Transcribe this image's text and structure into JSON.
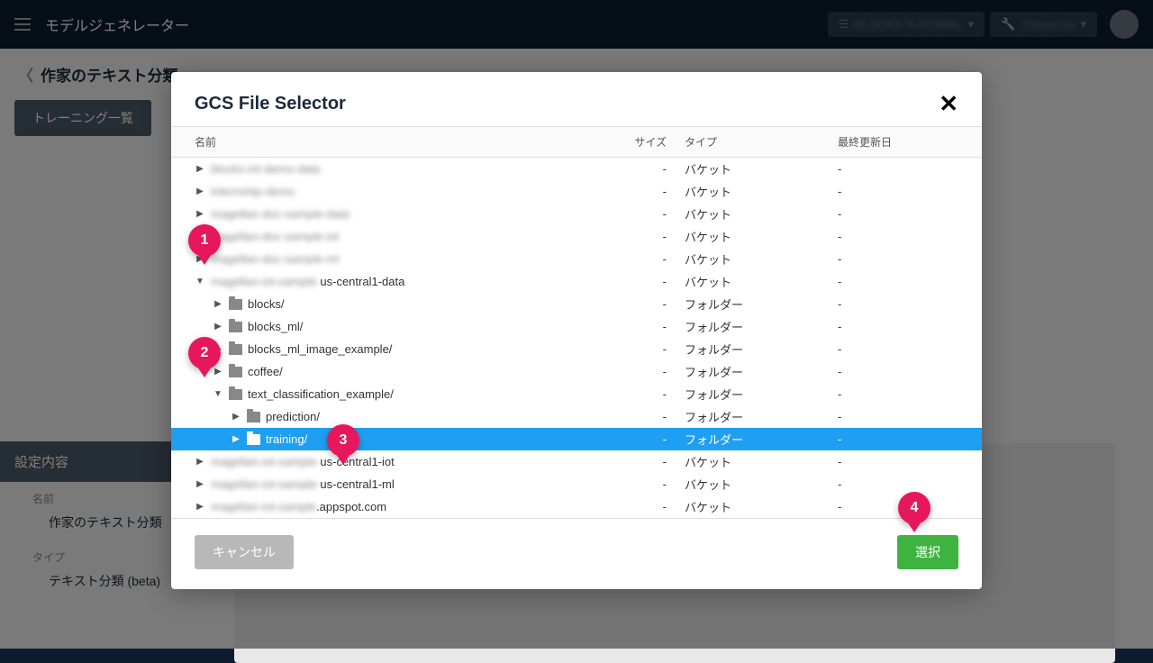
{
  "app": {
    "title": "モデルジェネレーター"
  },
  "breadcrumb": {
    "title": "作家のテキスト分類"
  },
  "tabs": {
    "training_list": "トレーニング一覧"
  },
  "settings": {
    "header": "設定内容",
    "name_label": "名前",
    "name_value": "作家のテキスト分類",
    "type_label": "タイプ",
    "type_value": "テキスト分類 (beta)"
  },
  "modal": {
    "title": "GCS File Selector",
    "columns": {
      "name": "名前",
      "size": "サイズ",
      "type": "タイプ",
      "updated": "最終更新日"
    },
    "buttons": {
      "cancel": "キャンセル",
      "select": "選択"
    },
    "types": {
      "bucket": "バケット",
      "folder": "フォルダー"
    },
    "rows": [
      {
        "indent": 1,
        "arrow": "right",
        "icon": "",
        "name": "blocks-ml-demo-data",
        "blur": true,
        "size": "-",
        "type": "バケット",
        "date": "-",
        "selected": false
      },
      {
        "indent": 1,
        "arrow": "right",
        "icon": "",
        "name": "internship-demo",
        "blur": true,
        "size": "-",
        "type": "バケット",
        "date": "-",
        "selected": false
      },
      {
        "indent": 1,
        "arrow": "right",
        "icon": "",
        "name": "magellan-doc-sample-data",
        "blur": true,
        "size": "-",
        "type": "バケット",
        "date": "-",
        "selected": false
      },
      {
        "indent": 1,
        "arrow": "right",
        "icon": "",
        "name": "magellan-doc-sample-iot",
        "blur": true,
        "size": "-",
        "type": "バケット",
        "date": "-",
        "selected": false
      },
      {
        "indent": 1,
        "arrow": "right",
        "icon": "",
        "name": "magellan-doc-sample-ml",
        "blur": true,
        "size": "-",
        "type": "バケット",
        "date": "-",
        "selected": false
      },
      {
        "indent": 1,
        "arrow": "down",
        "icon": "",
        "name_prefix": "magellan-iot-sample-",
        "name_suffix": "us-central1-data",
        "blur_prefix": true,
        "size": "-",
        "type": "バケット",
        "date": "-",
        "selected": false
      },
      {
        "indent": 2,
        "arrow": "right",
        "icon": "folder",
        "name": "blocks/",
        "blur": false,
        "size": "-",
        "type": "フォルダー",
        "date": "-",
        "selected": false
      },
      {
        "indent": 2,
        "arrow": "right",
        "icon": "folder",
        "name": "blocks_ml/",
        "blur": false,
        "size": "-",
        "type": "フォルダー",
        "date": "-",
        "selected": false
      },
      {
        "indent": 2,
        "arrow": "right",
        "icon": "folder",
        "name": "blocks_ml_image_example/",
        "blur": false,
        "size": "-",
        "type": "フォルダー",
        "date": "-",
        "selected": false
      },
      {
        "indent": 2,
        "arrow": "right",
        "icon": "folder",
        "name": "coffee/",
        "blur": false,
        "size": "-",
        "type": "フォルダー",
        "date": "-",
        "selected": false
      },
      {
        "indent": 2,
        "arrow": "down",
        "icon": "folder",
        "name": "text_classification_example/",
        "blur": false,
        "size": "-",
        "type": "フォルダー",
        "date": "-",
        "selected": false
      },
      {
        "indent": 3,
        "arrow": "right",
        "icon": "folder",
        "name": "prediction/",
        "blur": false,
        "size": "-",
        "type": "フォルダー",
        "date": "-",
        "selected": false
      },
      {
        "indent": 3,
        "arrow": "right",
        "icon": "folder",
        "name": "training/",
        "blur": false,
        "size": "-",
        "type": "フォルダー",
        "date": "-",
        "selected": true
      },
      {
        "indent": 1,
        "arrow": "right",
        "icon": "",
        "name_prefix": "magellan-iot-sample-",
        "name_suffix": "us-central1-iot",
        "blur_prefix": true,
        "size": "-",
        "type": "バケット",
        "date": "-",
        "selected": false
      },
      {
        "indent": 1,
        "arrow": "right",
        "icon": "",
        "name_prefix": "magellan-iot-sample-",
        "name_suffix": "us-central1-ml",
        "blur_prefix": true,
        "size": "-",
        "type": "バケット",
        "date": "-",
        "selected": false
      },
      {
        "indent": 1,
        "arrow": "right",
        "icon": "",
        "name_prefix": "magellan-iot-sample",
        "name_suffix": ".appspot.com",
        "blur_prefix": true,
        "size": "-",
        "type": "バケット",
        "date": "-",
        "selected": false
      }
    ]
  },
  "callouts": [
    "1",
    "2",
    "3",
    "4"
  ]
}
